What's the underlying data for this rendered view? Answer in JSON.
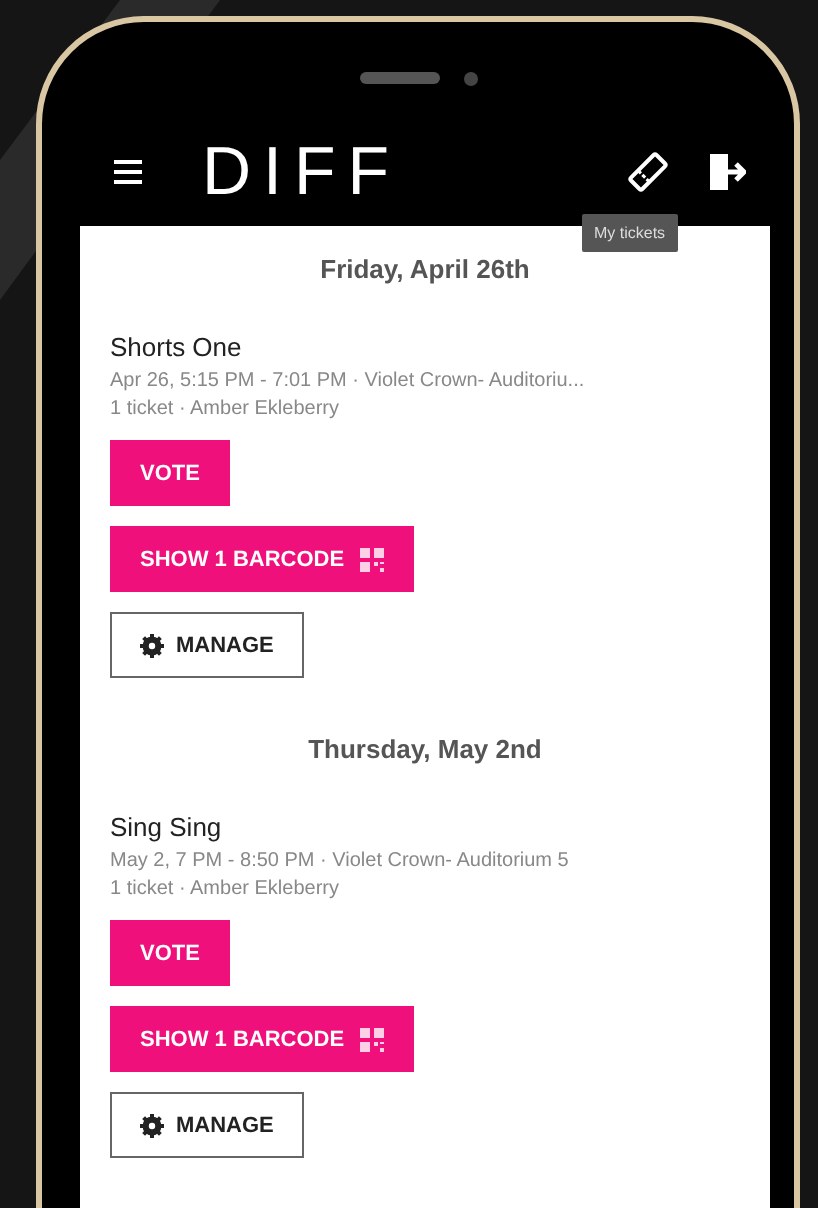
{
  "header": {
    "logo": "DIFF",
    "tooltip": "My tickets"
  },
  "days": [
    {
      "date": "Friday, April 26th",
      "events": [
        {
          "title": "Shorts One",
          "when": "Apr 26, 5:15 PM - 7:01 PM · Violet Crown- Auditoriu...",
          "tickets": "1 ticket · Amber Ekleberry",
          "vote": "VOTE",
          "barcode": "SHOW 1 BARCODE",
          "manage": "MANAGE"
        }
      ]
    },
    {
      "date": "Thursday, May 2nd",
      "events": [
        {
          "title": "Sing Sing",
          "when": "May 2, 7 PM - 8:50 PM · Violet Crown- Auditorium 5",
          "tickets": "1 ticket · Amber Ekleberry",
          "vote": "VOTE",
          "barcode": "SHOW 1 BARCODE",
          "manage": "MANAGE"
        }
      ]
    }
  ]
}
